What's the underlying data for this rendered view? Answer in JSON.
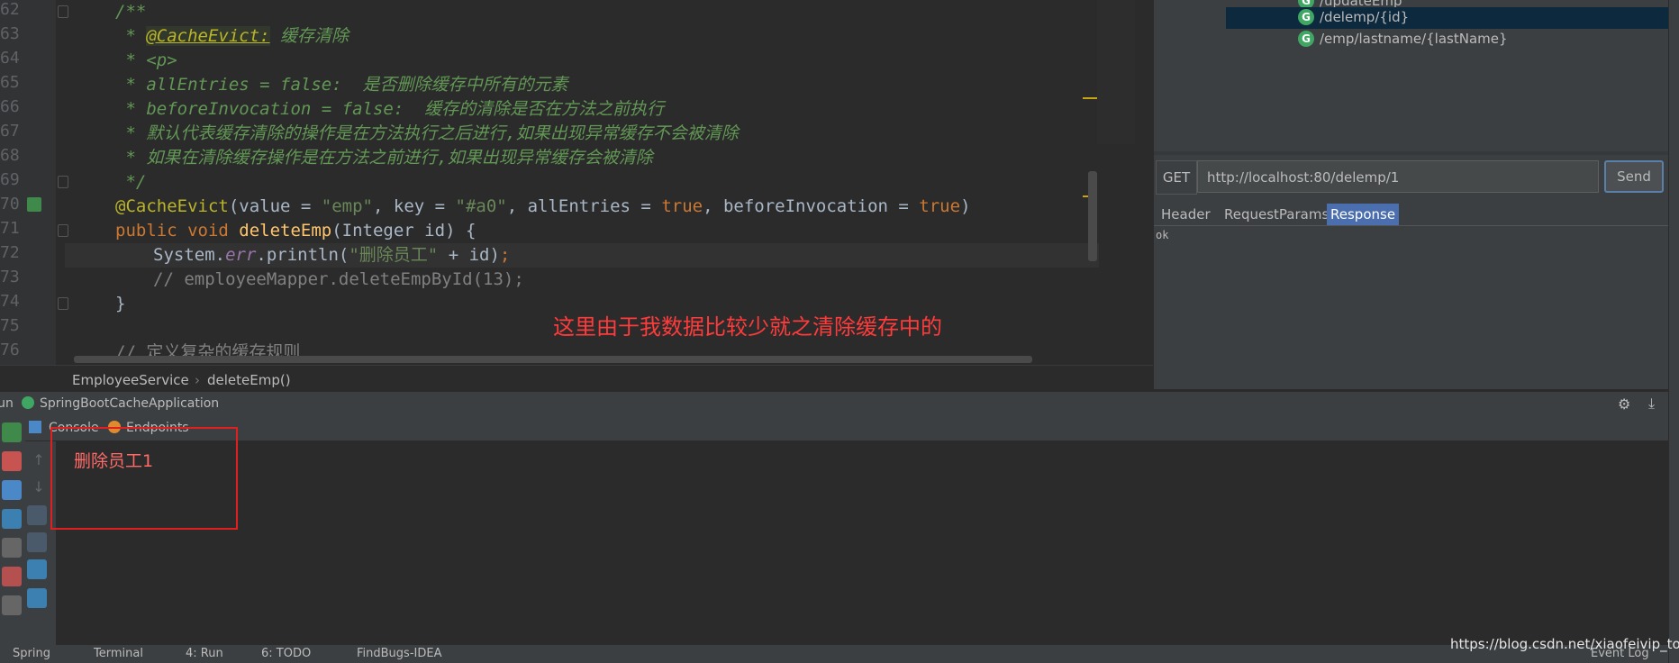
{
  "editor": {
    "line_numbers": [
      "62",
      "63",
      "64",
      "65",
      "66",
      "67",
      "68",
      "69",
      "70",
      "71",
      "72",
      "73",
      "74",
      "75",
      "76"
    ],
    "code": {
      "l62": "/**",
      "l63_prefix": " * ",
      "l63_tag": "@CacheEvict:",
      "l63_text": " 缓存清除",
      "l64": " * <p>",
      "l65": " * allEntries = false:  是否删除缓存中所有的元素",
      "l66": " * beforeInvocation = false:  缓存的清除是否在方法之前执行",
      "l67": " * 默认代表缓存清除的操作是在方法执行之后进行,如果出现异常缓存不会被清除",
      "l68": " * 如果在清除缓存操作是在方法之前进行,如果出现异常缓存会被清除",
      "l69": " */",
      "l70": {
        "anno": "@CacheEvict",
        "p1": "(value = ",
        "s1": "\"emp\"",
        "p2": ", key = ",
        "s2": "\"#a0\"",
        "p3": ", allEntries = ",
        "k1": "true",
        "p4": ", beforeInvocation = ",
        "k2": "true",
        "p5": ")"
      },
      "l71": {
        "kw": "public void ",
        "fn": "deleteEmp",
        "rest": "(Integer id) {"
      },
      "l72": {
        "a": "System.",
        "fld": "err",
        "b": ".println(",
        "s": "\"删除员工\"",
        "c": " + id)",
        "semi": ";"
      },
      "l73": "// employeeMapper.deleteEmpById(13);",
      "l74": "}",
      "l76": "// 定义复杂的缓存规则"
    },
    "overlay_note": "这里由于我数据比较少就之清除缓存中的"
  },
  "breadcrumb": {
    "class": "EmployeeService",
    "method": "deleteEmp()"
  },
  "rest_client": {
    "endpoints": [
      {
        "badge": "G",
        "path": "/updateEmp"
      },
      {
        "badge": "G",
        "path": "/delemp/{id}"
      },
      {
        "badge": "G",
        "path": "/emp/lastname/{lastName}"
      }
    ],
    "method": "GET",
    "url": "http://localhost:80/delemp/1",
    "send_label": "Send",
    "tabs": [
      "Header",
      "RequestParams",
      "Response"
    ],
    "response_body": "ok"
  },
  "run_panel": {
    "title_prefix": "Run",
    "config_name": "SpringBootCacheApplication",
    "tabs": [
      "Console",
      "Endpoints"
    ],
    "console_output": "删除员工1"
  },
  "status_bar": {
    "items": [
      "Spring",
      "Terminal",
      "4: Run",
      "6: TODO",
      "FindBugs-IDEA",
      "Event Log"
    ]
  },
  "watermark": "https://blog.csdn.net/xiaofeivip_top",
  "colors": {
    "editor_bg": "#2b2b2b",
    "panel_bg": "#3c3f41",
    "comment": "#629755",
    "keyword": "#cc7832",
    "string": "#6a8759",
    "annotation": "#bbb529",
    "error_text": "#ff6b68",
    "highlight_box": "#e02020"
  }
}
